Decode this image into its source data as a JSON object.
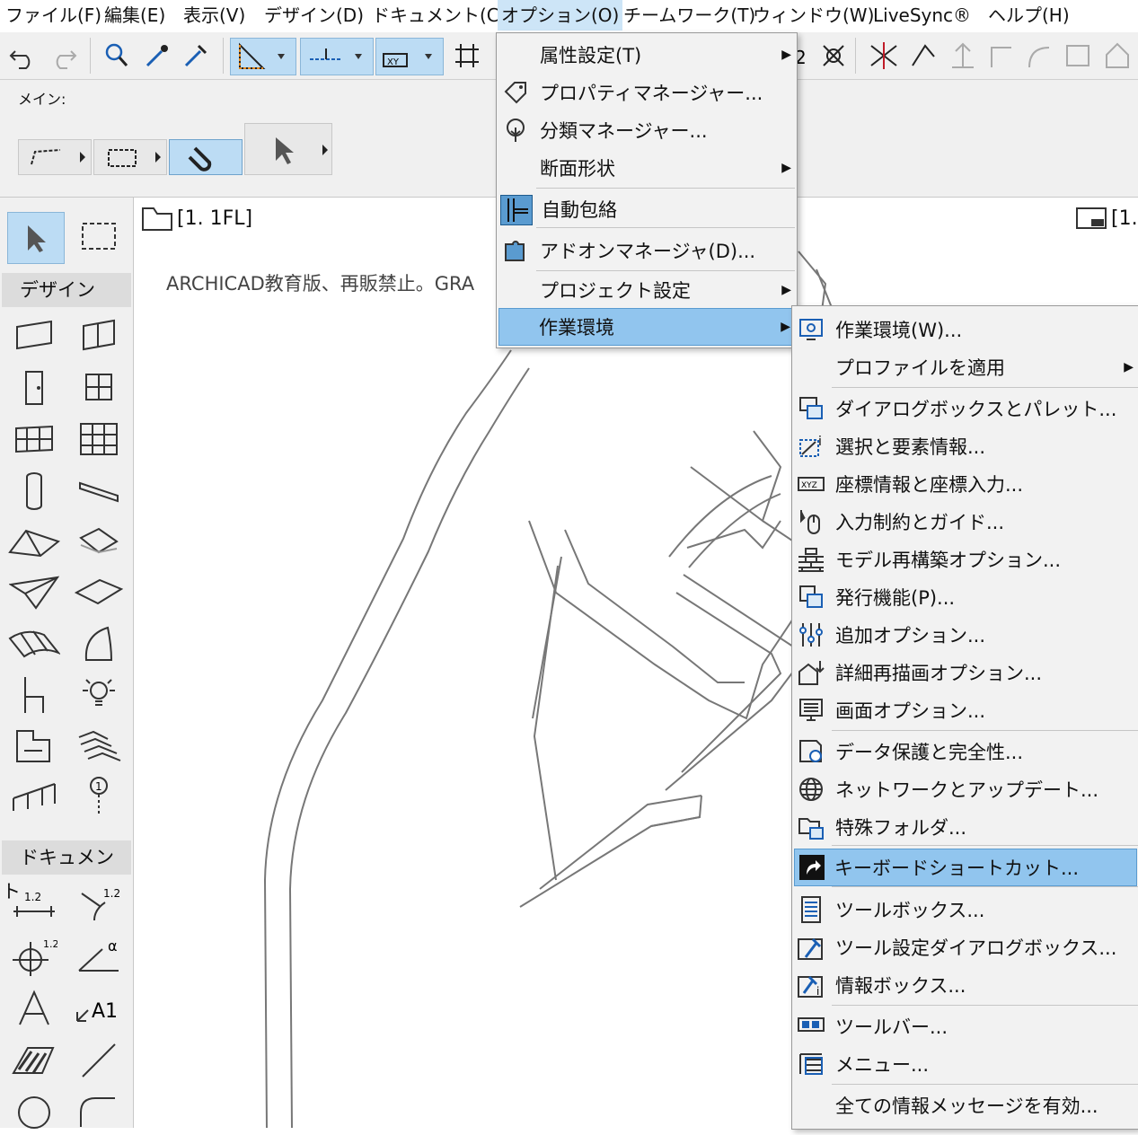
{
  "menubar": {
    "items": [
      "ファイル(F)",
      "編集(E)",
      "表示(V)",
      "デザイン(D)",
      "ドキュメント(C)",
      "オプション(O)",
      "チームワーク(T)",
      "ウィンドウ(W)",
      "LiveSync®",
      "ヘルプ(H)"
    ]
  },
  "main_palette": {
    "label": "メイン:"
  },
  "toolbox": {
    "design_header": "デザイン",
    "document_header": "ドキュメント"
  },
  "canvas": {
    "tab_label": "[1. 1FL]",
    "tab_label_right": "[1.",
    "watermark": "ARCHICAD教育版、再販禁止。GRA"
  },
  "options_menu": {
    "items": [
      "属性設定(T)",
      "プロパティマネージャー...",
      "分類マネージャー...",
      "断面形状",
      "自動包絡",
      "アドオンマネージャ(D)...",
      "プロジェクト設定",
      "作業環境"
    ]
  },
  "work_env_menu": {
    "items": [
      "作業環境(W)...",
      "プロファイルを適用",
      "ダイアログボックスとパレット...",
      "選択と要素情報...",
      "座標情報と座標入力...",
      "入力制約とガイド...",
      "モデル再構築オプション...",
      "発行機能(P)...",
      "追加オプション...",
      "詳細再描画オプション...",
      "画面オプション...",
      "データ保護と完全性...",
      "ネットワークとアップデート...",
      "特殊フォルダ...",
      "キーボードショートカット...",
      "ツールボックス...",
      "ツール設定ダイアログボックス...",
      "情報ボックス...",
      "ツールバー...",
      "メニュー...",
      "全ての情報メッセージを有効..."
    ]
  },
  "colors": {
    "highlight": "#91c5ee",
    "selected": "#bcdcf4"
  }
}
